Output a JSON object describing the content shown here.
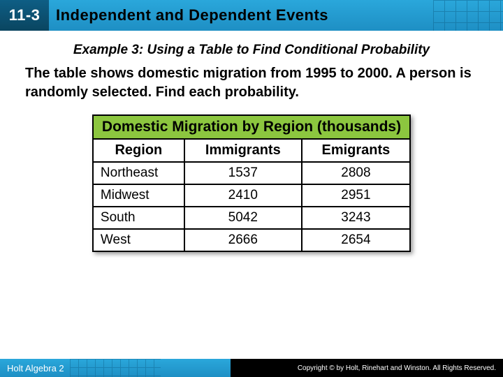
{
  "header": {
    "lesson_number": "11-3",
    "title": "Independent and Dependent Events"
  },
  "example": {
    "title": "Example 3: Using a Table to Find Conditional Probability",
    "body": "The table shows domestic migration from 1995 to 2000. A person is randomly selected. Find each probability."
  },
  "chart_data": {
    "type": "table",
    "title": "Domestic Migration by Region (thousands)",
    "columns": [
      "Region",
      "Immigrants",
      "Emigrants"
    ],
    "rows": [
      {
        "region": "Northeast",
        "immigrants": "1537",
        "emigrants": "2808"
      },
      {
        "region": "Midwest",
        "immigrants": "2410",
        "emigrants": "2951"
      },
      {
        "region": "South",
        "immigrants": "5042",
        "emigrants": "3243"
      },
      {
        "region": "West",
        "immigrants": "2666",
        "emigrants": "2654"
      }
    ]
  },
  "footer": {
    "left": "Holt Algebra 2",
    "right": "Copyright © by Holt, Rinehart and Winston. All Rights Reserved."
  }
}
